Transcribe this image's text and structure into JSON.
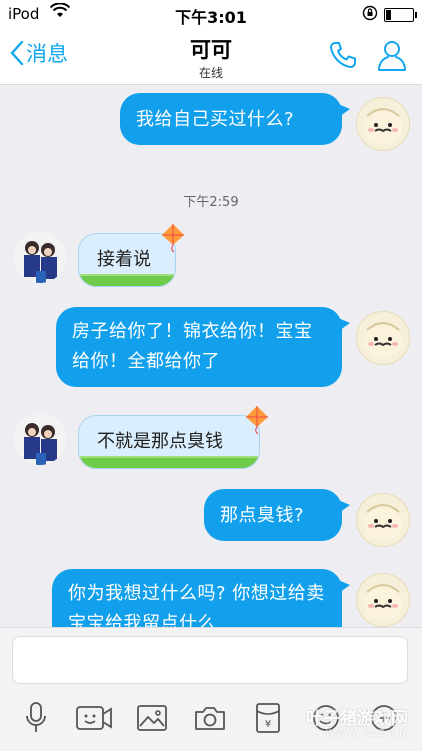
{
  "status_bar": {
    "carrier": "iPod",
    "time": "下午3:01"
  },
  "nav": {
    "back_label": "消息",
    "title": "可可",
    "subtitle": "在线"
  },
  "messages": [
    {
      "sender": "me",
      "text": "我给自己买过什么?"
    },
    {
      "sender": "other",
      "text": "接着说"
    },
    {
      "sender": "me",
      "text": "房子给你了！锦衣给你！宝宝给你！全都给你了"
    },
    {
      "sender": "other",
      "text": "不就是那点臭钱"
    },
    {
      "sender": "me",
      "text": "那点臭钱?"
    },
    {
      "sender": "me",
      "text": "你为我想过什么吗? 你想过给卖宝宝给我留点什么"
    }
  ],
  "timestamp": "下午2:59",
  "input": {
    "placeholder": ""
  },
  "toolbar": [
    "mic-icon",
    "video-icon",
    "image-icon",
    "camera-icon",
    "red-packet-icon",
    "emoji-icon",
    "plus-icon"
  ],
  "watermark": {
    "main": "叶子猪游戏网",
    "sub": "WWW.YZZ.CN"
  },
  "colors": {
    "accent": "#12a0ec",
    "background": "#eeeef2"
  }
}
